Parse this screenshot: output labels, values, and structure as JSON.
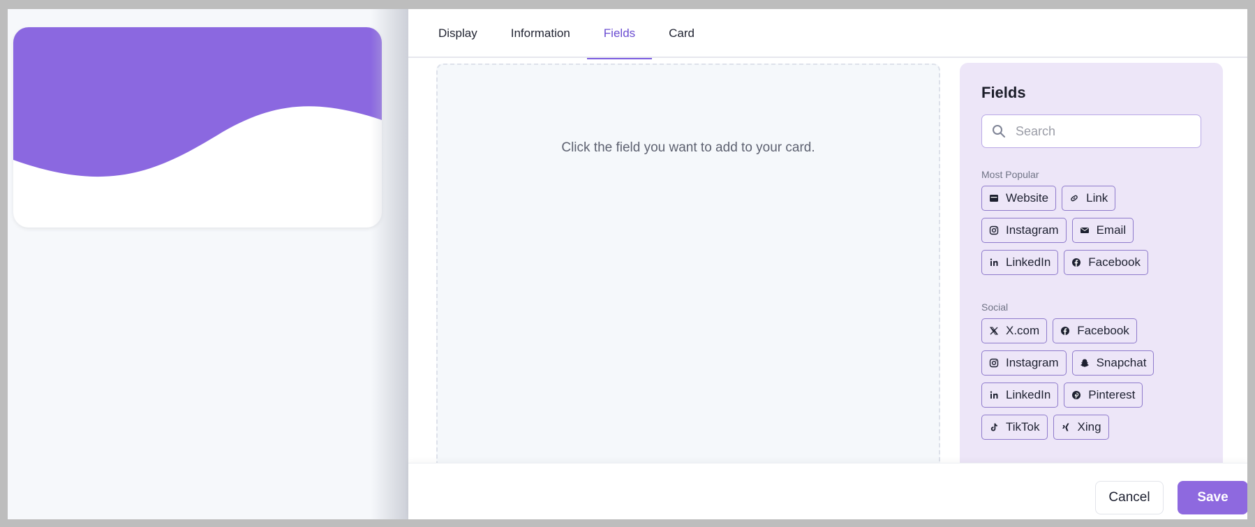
{
  "tabs": [
    {
      "label": "Display"
    },
    {
      "label": "Information"
    },
    {
      "label": "Fields",
      "active": true
    },
    {
      "label": "Card"
    }
  ],
  "dropzone": {
    "text": "Click the field you want to add to your card."
  },
  "fields": {
    "title": "Fields",
    "search_placeholder": "Search",
    "sections": [
      {
        "label": "Most Popular",
        "items": [
          {
            "label": "Website",
            "icon": "browser-icon"
          },
          {
            "label": "Link",
            "icon": "link-icon"
          },
          {
            "label": "Instagram",
            "icon": "instagram-icon"
          },
          {
            "label": "Email",
            "icon": "envelope-icon"
          },
          {
            "label": "LinkedIn",
            "icon": "linkedin-icon"
          },
          {
            "label": "Facebook",
            "icon": "facebook-icon"
          }
        ]
      },
      {
        "label": "Social",
        "items": [
          {
            "label": "X.com",
            "icon": "x-icon"
          },
          {
            "label": "Facebook",
            "icon": "facebook-icon"
          },
          {
            "label": "Instagram",
            "icon": "instagram-icon"
          },
          {
            "label": "Snapchat",
            "icon": "snapchat-icon"
          },
          {
            "label": "LinkedIn",
            "icon": "linkedin-icon"
          },
          {
            "label": "Pinterest",
            "icon": "pinterest-icon"
          },
          {
            "label": "TikTok",
            "icon": "tiktok-icon"
          },
          {
            "label": "Xing",
            "icon": "xing-icon"
          }
        ]
      }
    ]
  },
  "footer": {
    "cancel_label": "Cancel",
    "save_label": "Save"
  },
  "colors": {
    "accent": "#8e69df",
    "card_wave": "#8b68e0",
    "fields_bg": "#ede6f8"
  }
}
